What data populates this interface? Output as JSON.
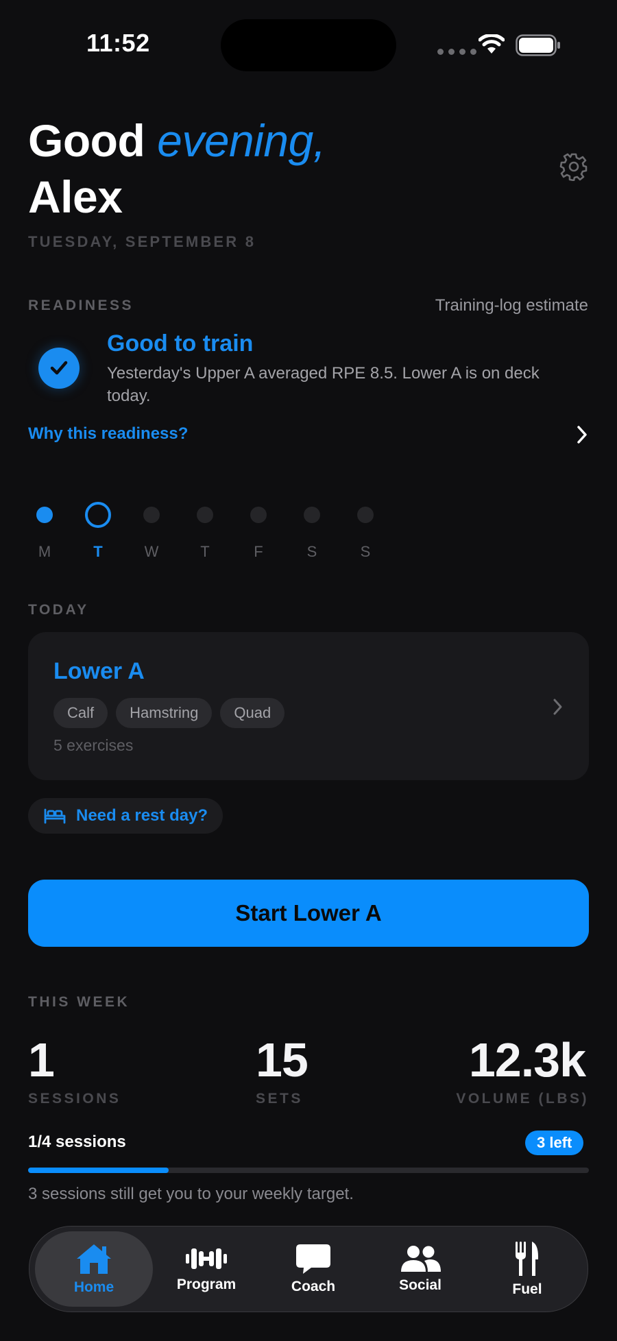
{
  "status_bar": {
    "time": "11:52"
  },
  "header": {
    "greeting_word": "Good",
    "greeting_accent": "evening,",
    "name": "Alex",
    "date": "TUESDAY, SEPTEMBER 8"
  },
  "readiness": {
    "section_label": "READINESS",
    "note": "Training-log estimate",
    "title": "Good to train",
    "description": "Yesterday's Upper A averaged RPE 8.5. Lower A is on deck today.",
    "why_link": "Why this readiness?"
  },
  "week": {
    "days": [
      {
        "letter": "M",
        "state": "done"
      },
      {
        "letter": "T",
        "state": "today"
      },
      {
        "letter": "W",
        "state": "upcoming"
      },
      {
        "letter": "T",
        "state": "upcoming"
      },
      {
        "letter": "F",
        "state": "upcoming"
      },
      {
        "letter": "S",
        "state": "upcoming"
      },
      {
        "letter": "S",
        "state": "upcoming"
      }
    ]
  },
  "today": {
    "section_label": "TODAY",
    "workout_name": "Lower A",
    "muscles": [
      "Calf",
      "Hamstring",
      "Quad"
    ],
    "exercise_count": "5 exercises",
    "rest_day_label": "Need a rest day?",
    "start_button": "Start Lower A"
  },
  "this_week": {
    "section_label": "THIS WEEK",
    "sessions_value": "1",
    "sessions_label": "SESSIONS",
    "sets_value": "15",
    "sets_label": "SETS",
    "volume_value": "12.3k",
    "volume_label": "VOLUME (LBS)",
    "progress_label": "1/4 sessions",
    "progress_fraction": 0.25,
    "left_badge": "3 left",
    "progress_note": "3 sessions still get you to your weekly target."
  },
  "tabs": [
    {
      "label": "Home",
      "icon": "house-icon",
      "active": true
    },
    {
      "label": "Program",
      "icon": "dumbbell-icon",
      "active": false
    },
    {
      "label": "Coach",
      "icon": "chat-bubble-icon",
      "active": false
    },
    {
      "label": "Social",
      "icon": "people-icon",
      "active": false
    },
    {
      "label": "Fuel",
      "icon": "fork-knife-icon",
      "active": false
    }
  ],
  "colors": {
    "accent": "#1a8cf0",
    "button": "#0a8dfc",
    "background": "#0e0e10",
    "card": "#19191c"
  }
}
